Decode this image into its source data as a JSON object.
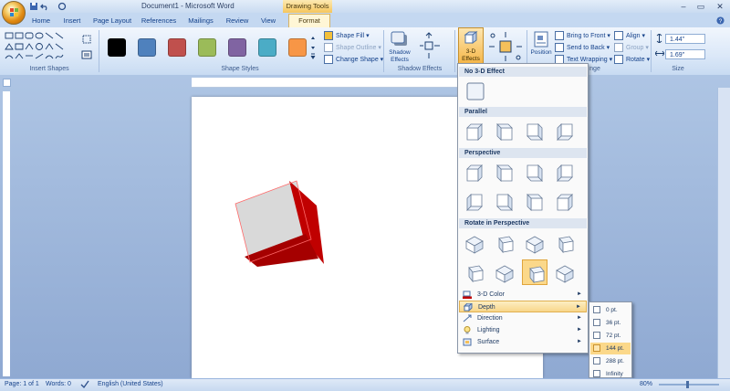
{
  "window": {
    "title": "Document1 - Microsoft Word",
    "contextual_group": "Drawing Tools"
  },
  "tabs": [
    "Home",
    "Insert",
    "Page Layout",
    "References",
    "Mailings",
    "Review",
    "View",
    "Format"
  ],
  "active_tab": "Format",
  "ribbon": {
    "groups": [
      "Insert Shapes",
      "Shape Styles",
      "Shadow Effects",
      "3-D Effects",
      "Arrange",
      "Size"
    ],
    "shape_style_colors": [
      "#000000",
      "#4f81bd",
      "#c0504d",
      "#9bbb59",
      "#8064a2",
      "#4bacc6",
      "#f79646"
    ],
    "shape_fill": "Shape Fill",
    "shape_outline": "Shape Outline",
    "change_shape": "Change Shape",
    "shadow_effects": "Shadow Effects",
    "three_d_effects": "3-D Effects",
    "position": "Position",
    "bring_to_front": "Bring to Front",
    "send_to_back": "Send to Back",
    "text_wrapping": "Text Wrapping",
    "align": "Align",
    "group": "Group",
    "rotate": "Rotate",
    "height": "1.44\"",
    "width": "1.69\"",
    "arrange_tail": "nge"
  },
  "menu": {
    "no_effect_header": "No 3-D Effect",
    "sections": [
      "Parallel",
      "Perspective",
      "Rotate in Perspective"
    ],
    "items": [
      {
        "label": "3-D Color",
        "has_submenu": true
      },
      {
        "label": "Depth",
        "has_submenu": true,
        "highlighted": true
      },
      {
        "label": "Direction",
        "has_submenu": true
      },
      {
        "label": "Lighting",
        "has_submenu": true
      },
      {
        "label": "Surface",
        "has_submenu": true
      }
    ]
  },
  "depth_submenu": {
    "options": [
      "0 pt.",
      "36 pt.",
      "72 pt.",
      "144 pt.",
      "288 pt.",
      "Infinity"
    ],
    "selected": "144 pt."
  },
  "status": {
    "page": "Page: 1 of 1",
    "words": "Words: 0",
    "language": "English (United States)",
    "zoom": "80%"
  },
  "colors": {
    "cube_front": "#d9d9d9",
    "cube_side": "#c00000",
    "highlight": "#fbd88a"
  }
}
